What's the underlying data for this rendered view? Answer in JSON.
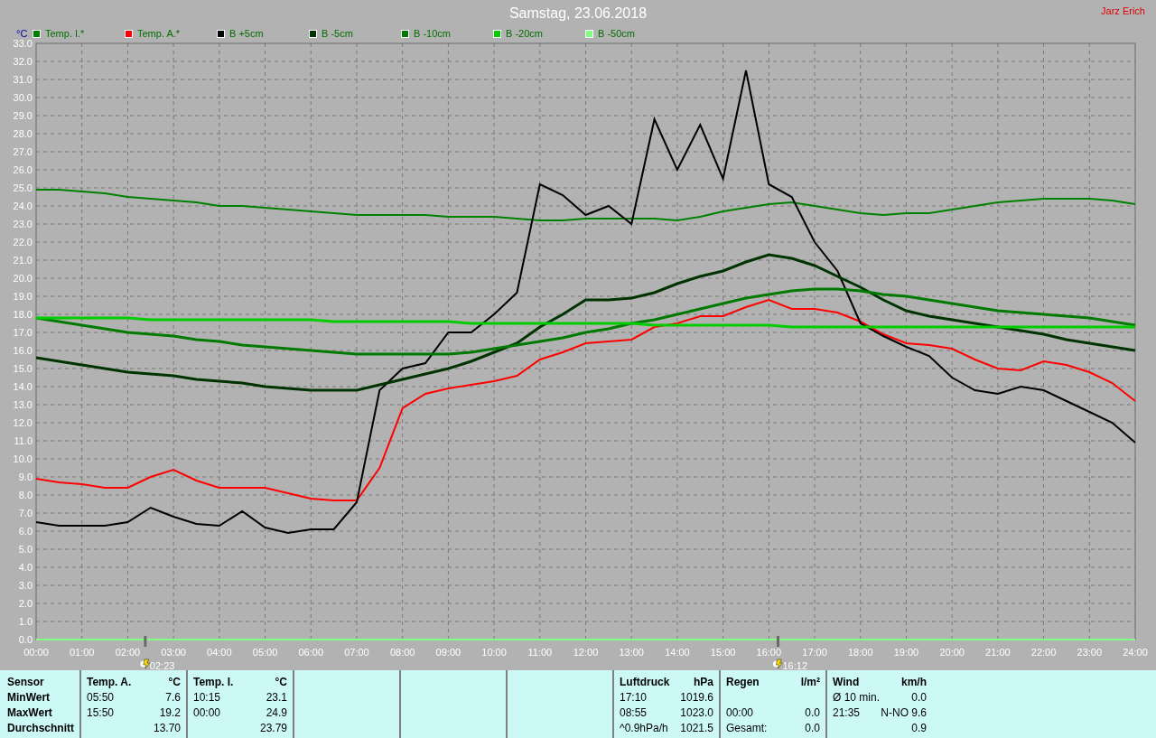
{
  "title": "Samstag, 23.06.2018",
  "user": "Jarz Erich",
  "chart": {
    "unit": "°C",
    "markers": [
      {
        "time": "02:23"
      },
      {
        "time": "16:12"
      }
    ],
    "chart_data": {
      "type": "line",
      "legend": "top",
      "grid": true,
      "x": [
        0,
        0.5,
        1,
        1.5,
        2,
        2.5,
        3,
        3.5,
        4,
        4.5,
        5,
        5.5,
        6,
        6.5,
        7,
        7.5,
        8,
        8.5,
        9,
        9.5,
        10,
        10.5,
        11,
        11.5,
        12,
        12.5,
        13,
        13.5,
        14,
        14.5,
        15,
        15.5,
        16,
        16.5,
        17,
        17.5,
        18,
        18.5,
        19,
        19.5,
        20,
        20.5,
        21,
        21.5,
        22,
        22.5,
        23,
        23.5,
        24
      ],
      "xlim": [
        0,
        24
      ],
      "ylim": [
        0,
        33
      ],
      "xticks": [
        {
          "value": 0,
          "label": "00:00"
        },
        {
          "value": 1,
          "label": "01:00"
        },
        {
          "value": 2,
          "label": "02:00"
        },
        {
          "value": 3,
          "label": "03:00"
        },
        {
          "value": 4,
          "label": "04:00"
        },
        {
          "value": 5,
          "label": "05:00"
        },
        {
          "value": 6,
          "label": "06:00"
        },
        {
          "value": 7,
          "label": "07:00"
        },
        {
          "value": 8,
          "label": "08:00"
        },
        {
          "value": 9,
          "label": "09:00"
        },
        {
          "value": 10,
          "label": "10:00"
        },
        {
          "value": 11,
          "label": "11:00"
        },
        {
          "value": 12,
          "label": "12:00"
        },
        {
          "value": 13,
          "label": "13:00"
        },
        {
          "value": 14,
          "label": "14:00"
        },
        {
          "value": 15,
          "label": "15:00"
        },
        {
          "value": 16,
          "label": "16:00"
        },
        {
          "value": 17,
          "label": "17:00"
        },
        {
          "value": 18,
          "label": "18:00"
        },
        {
          "value": 19,
          "label": "19:00"
        },
        {
          "value": 20,
          "label": "20:00"
        },
        {
          "value": 21,
          "label": "21:00"
        },
        {
          "value": 22,
          "label": "22:00"
        },
        {
          "value": 23,
          "label": "23:00"
        },
        {
          "value": 24,
          "label": "24:00"
        }
      ],
      "yticks": [
        {
          "value": 0,
          "label": "0.0"
        },
        {
          "value": 1,
          "label": "1.0"
        },
        {
          "value": 2,
          "label": "2.0"
        },
        {
          "value": 3,
          "label": "3.0"
        },
        {
          "value": 4,
          "label": "4.0"
        },
        {
          "value": 5,
          "label": "5.0"
        },
        {
          "value": 6,
          "label": "6.0"
        },
        {
          "value": 7,
          "label": "7.0"
        },
        {
          "value": 8,
          "label": "8.0"
        },
        {
          "value": 9,
          "label": "9.0"
        },
        {
          "value": 10,
          "label": "10.0"
        },
        {
          "value": 11,
          "label": "11.0"
        },
        {
          "value": 12,
          "label": "12.0"
        },
        {
          "value": 13,
          "label": "13.0"
        },
        {
          "value": 14,
          "label": "14.0"
        },
        {
          "value": 15,
          "label": "15.0"
        },
        {
          "value": 16,
          "label": "16.0"
        },
        {
          "value": 17,
          "label": "17.0"
        },
        {
          "value": 18,
          "label": "18.0"
        },
        {
          "value": 19,
          "label": "19.0"
        },
        {
          "value": 20,
          "label": "20.0"
        },
        {
          "value": 21,
          "label": "21.0"
        },
        {
          "value": 22,
          "label": "22.0"
        },
        {
          "value": 23,
          "label": "23.0"
        },
        {
          "value": 24,
          "label": "24.0"
        },
        {
          "value": 25,
          "label": "25.0"
        },
        {
          "value": 26,
          "label": "26.0"
        },
        {
          "value": 27,
          "label": "27.0"
        },
        {
          "value": 28,
          "label": "28.0"
        },
        {
          "value": 29,
          "label": "29.0"
        },
        {
          "value": 30,
          "label": "30.0"
        },
        {
          "value": 31,
          "label": "31.0"
        },
        {
          "value": 32,
          "label": "32.0"
        },
        {
          "value": 33,
          "label": "33.0"
        }
      ],
      "series": [
        {
          "name": "Temp. I.*",
          "color": "#008000",
          "values": [
            24.9,
            24.9,
            24.8,
            24.7,
            24.5,
            24.4,
            24.3,
            24.2,
            24.0,
            24.0,
            23.9,
            23.8,
            23.7,
            23.6,
            23.5,
            23.5,
            23.5,
            23.5,
            23.4,
            23.4,
            23.4,
            23.3,
            23.2,
            23.2,
            23.3,
            23.3,
            23.3,
            23.3,
            23.2,
            23.4,
            23.7,
            23.9,
            24.1,
            24.2,
            24.0,
            23.8,
            23.6,
            23.5,
            23.6,
            23.6,
            23.8,
            24.0,
            24.2,
            24.3,
            24.4,
            24.4,
            24.4,
            24.3,
            24.1
          ]
        },
        {
          "name": "Temp. A.*",
          "color": "#ff0000",
          "values": [
            8.9,
            8.7,
            8.6,
            8.4,
            8.4,
            9.0,
            9.4,
            8.8,
            8.4,
            8.4,
            8.4,
            8.1,
            7.8,
            7.7,
            7.7,
            9.5,
            12.8,
            13.6,
            13.9,
            14.1,
            14.3,
            14.6,
            15.5,
            15.9,
            16.4,
            16.5,
            16.6,
            17.3,
            17.5,
            17.9,
            17.9,
            18.4,
            18.8,
            18.3,
            18.3,
            18.1,
            17.6,
            16.9,
            16.4,
            16.3,
            16.1,
            15.5,
            15.0,
            14.9,
            15.4,
            15.2,
            14.8,
            14.2,
            13.2
          ]
        },
        {
          "name": "B +5cm",
          "color": "#000000",
          "values": [
            6.5,
            6.3,
            6.3,
            6.3,
            6.5,
            7.3,
            6.8,
            6.4,
            6.3,
            7.1,
            6.2,
            5.9,
            6.1,
            6.1,
            7.6,
            13.8,
            15.0,
            15.3,
            17.0,
            17.0,
            18.0,
            19.2,
            25.2,
            24.6,
            23.5,
            24.0,
            23.0,
            28.8,
            26.0,
            28.5,
            25.5,
            31.5,
            25.2,
            24.5,
            22.0,
            20.4,
            17.5,
            16.8,
            16.2,
            15.7,
            14.5,
            13.8,
            13.6,
            14.0,
            13.8,
            13.2,
            12.6,
            12.0,
            10.9
          ]
        },
        {
          "name": "B -5cm",
          "color": "#003300",
          "values": [
            15.6,
            15.4,
            15.2,
            15.0,
            14.8,
            14.7,
            14.6,
            14.4,
            14.3,
            14.2,
            14.0,
            13.9,
            13.8,
            13.8,
            13.8,
            14.1,
            14.4,
            14.7,
            15.0,
            15.4,
            15.9,
            16.4,
            17.3,
            18.0,
            18.8,
            18.8,
            18.9,
            19.2,
            19.7,
            20.1,
            20.4,
            20.9,
            21.3,
            21.1,
            20.7,
            20.1,
            19.5,
            18.8,
            18.2,
            17.9,
            17.7,
            17.5,
            17.3,
            17.1,
            16.9,
            16.6,
            16.4,
            16.2,
            16.0
          ]
        },
        {
          "name": "B -10cm",
          "color": "#007a00",
          "values": [
            17.8,
            17.6,
            17.4,
            17.2,
            17.0,
            16.9,
            16.8,
            16.6,
            16.5,
            16.3,
            16.2,
            16.1,
            16.0,
            15.9,
            15.8,
            15.8,
            15.8,
            15.8,
            15.8,
            15.9,
            16.1,
            16.3,
            16.5,
            16.7,
            17.0,
            17.2,
            17.5,
            17.7,
            18.0,
            18.3,
            18.6,
            18.9,
            19.1,
            19.3,
            19.4,
            19.4,
            19.3,
            19.1,
            19.0,
            18.8,
            18.6,
            18.4,
            18.2,
            18.1,
            18.0,
            17.9,
            17.8,
            17.6,
            17.4
          ]
        },
        {
          "name": "B -20cm",
          "color": "#00cc00",
          "values": [
            17.8,
            17.8,
            17.8,
            17.8,
            17.8,
            17.7,
            17.7,
            17.7,
            17.7,
            17.7,
            17.7,
            17.7,
            17.7,
            17.6,
            17.6,
            17.6,
            17.6,
            17.6,
            17.6,
            17.5,
            17.5,
            17.5,
            17.5,
            17.5,
            17.5,
            17.5,
            17.5,
            17.4,
            17.4,
            17.4,
            17.4,
            17.4,
            17.4,
            17.3,
            17.3,
            17.3,
            17.3,
            17.3,
            17.3,
            17.3,
            17.3,
            17.3,
            17.3,
            17.3,
            17.3,
            17.3,
            17.3,
            17.3,
            17.3
          ]
        },
        {
          "name": "B -50cm",
          "color": "#80ff80",
          "values": [
            0,
            0,
            0,
            0,
            0,
            0,
            0,
            0,
            0,
            0,
            0,
            0,
            0,
            0,
            0,
            0,
            0,
            0,
            0,
            0,
            0,
            0,
            0,
            0,
            0,
            0,
            0,
            0,
            0,
            0,
            0,
            0,
            0,
            0,
            0,
            0,
            0,
            0,
            0,
            0,
            0,
            0,
            0,
            0,
            0,
            0,
            0,
            0,
            0
          ]
        }
      ]
    }
  },
  "summary": {
    "row_labels": [
      "Sensor",
      "MinWert",
      "MaxWert",
      "Durchschnitt"
    ],
    "blocks": [
      {
        "kind": "values",
        "header": [
          "Temp. A.",
          "°C"
        ],
        "rows": [
          [
            "05:50",
            "7.6"
          ],
          [
            "15:50",
            "19.2"
          ],
          [
            null,
            "13.70"
          ]
        ]
      },
      {
        "kind": "values",
        "header": [
          "Temp. I.",
          "°C"
        ],
        "rows": [
          [
            "10:15",
            "23.1"
          ],
          [
            "00:00",
            "24.9"
          ],
          [
            null,
            "23.79"
          ]
        ]
      },
      {
        "kind": "empty"
      },
      {
        "kind": "empty"
      },
      {
        "kind": "empty"
      },
      {
        "kind": "values",
        "header": [
          "Luftdruck",
          "hPa"
        ],
        "rows": [
          [
            "17:10",
            "1019.6"
          ],
          [
            "08:55",
            "1023.0"
          ],
          [
            "^0.9hPa/h",
            "1021.5"
          ]
        ]
      },
      {
        "kind": "values",
        "header": [
          "Regen",
          "l/m²"
        ],
        "rows": [
          [
            null,
            null
          ],
          [
            "00:00",
            "0.0"
          ],
          [
            "Gesamt:",
            "0.0"
          ]
        ]
      },
      {
        "kind": "values",
        "header": [
          "Wind",
          "km/h"
        ],
        "rows": [
          [
            "Ø 10 min.",
            "0.0"
          ],
          [
            "21:35",
            "N-NO 9.6"
          ],
          [
            null,
            "0.9"
          ]
        ]
      }
    ]
  }
}
